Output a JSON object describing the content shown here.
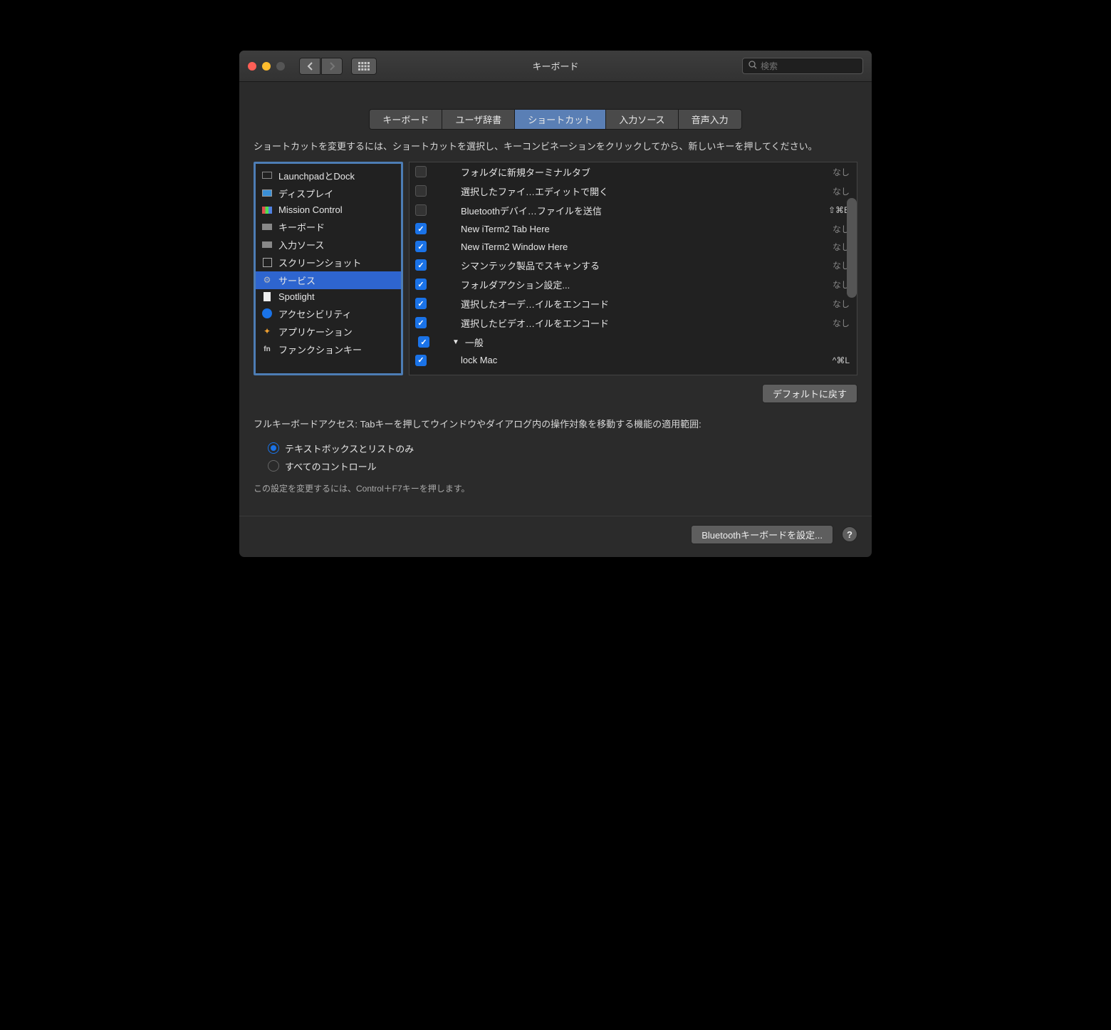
{
  "window": {
    "title": "キーボード"
  },
  "search": {
    "placeholder": "検索"
  },
  "tabs": [
    {
      "label": "キーボード",
      "active": false
    },
    {
      "label": "ユーザ辞書",
      "active": false
    },
    {
      "label": "ショートカット",
      "active": true
    },
    {
      "label": "入力ソース",
      "active": false
    },
    {
      "label": "音声入力",
      "active": false
    }
  ],
  "instruction": "ショートカットを変更するには、ショートカットを選択し、キーコンビネーションをクリックしてから、新しいキーを押してください。",
  "sidebar": {
    "items": [
      {
        "label": "LaunchpadとDock",
        "icon": "launchpad"
      },
      {
        "label": "ディスプレイ",
        "icon": "monitor"
      },
      {
        "label": "Mission Control",
        "icon": "mc"
      },
      {
        "label": "キーボード",
        "icon": "keyboard"
      },
      {
        "label": "入力ソース",
        "icon": "keyboard"
      },
      {
        "label": "スクリーンショット",
        "icon": "screenshot"
      },
      {
        "label": "サービス",
        "icon": "gear",
        "selected": true
      },
      {
        "label": "Spotlight",
        "icon": "doc"
      },
      {
        "label": "アクセシビリティ",
        "icon": "acc"
      },
      {
        "label": "アプリケーション",
        "icon": "app"
      },
      {
        "label": "ファンクションキー",
        "icon": "fn"
      }
    ]
  },
  "shortcuts": [
    {
      "checked": false,
      "label": "フォルダに新規ターミナルタブ",
      "key": "なし"
    },
    {
      "checked": false,
      "label": "選択したファイ…エディットで開く",
      "key": "なし"
    },
    {
      "checked": false,
      "label": "Bluetoothデバイ…ファイルを送信",
      "key": "⇧⌘B"
    },
    {
      "checked": true,
      "label": "New iTerm2 Tab Here",
      "key": "なし"
    },
    {
      "checked": true,
      "label": "New iTerm2 Window Here",
      "key": "なし"
    },
    {
      "checked": true,
      "label": "シマンテック製品でスキャンする",
      "key": "なし"
    },
    {
      "checked": true,
      "label": "フォルダアクション設定...",
      "key": "なし"
    },
    {
      "checked": true,
      "label": "選択したオーデ…イルをエンコード",
      "key": "なし"
    },
    {
      "checked": true,
      "label": "選択したビデオ…イルをエンコード",
      "key": "なし"
    },
    {
      "group": true,
      "checked": true,
      "label": "一般"
    },
    {
      "checked": true,
      "label": "lock Mac",
      "key": "^⌘L"
    }
  ],
  "restore_defaults": "デフォルトに戻す",
  "fka_label": "フルキーボードアクセス: Tabキーを押してウインドウやダイアログ内の操作対象を移動する機能の適用範囲:",
  "fka_radios": [
    {
      "label": "テキストボックスとリストのみ",
      "checked": true
    },
    {
      "label": "すべてのコントロール",
      "checked": false
    }
  ],
  "fka_hint": "この設定を変更するには、Control＋F7キーを押します。",
  "footer": {
    "bluetooth_btn": "Bluetoothキーボードを設定..."
  }
}
